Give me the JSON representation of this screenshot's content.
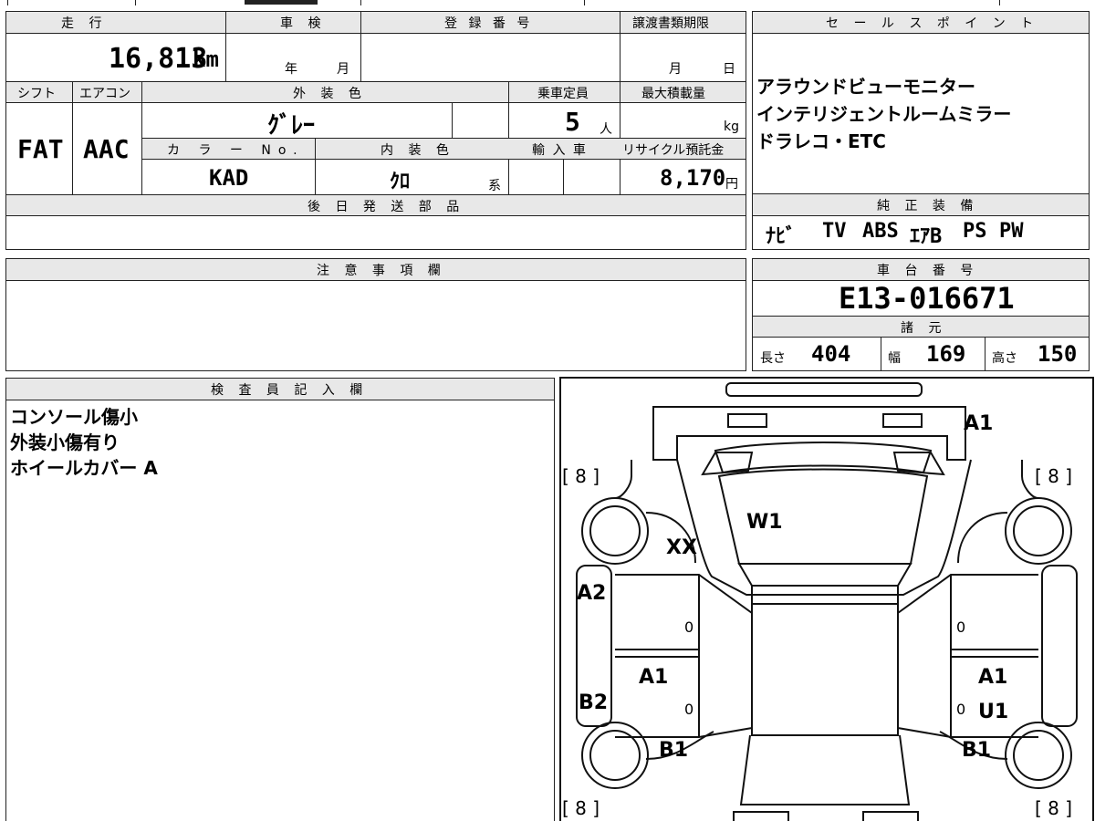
{
  "top_strip": [
    "",
    "",
    "",
    "",
    ""
  ],
  "basic": {
    "mileage_h": "走 行",
    "mileage": "16,813",
    "mileage_unit": "km",
    "inspection_h": "車 検",
    "inspection_year": "年",
    "inspection_month": "月",
    "reg_h": "登 録 番 号",
    "reg_value": "",
    "transfer_h": "譲渡書類期限",
    "transfer_month": "月",
    "transfer_day": "日",
    "shift_h": "シフト",
    "shift": "FAT",
    "aircon_h": "エアコン",
    "aircon": "AAC",
    "exterior_h": "外 装 色",
    "exterior": "ｸﾞﾚｰ",
    "capacity_h": "乗車定員",
    "capacity": "5",
    "capacity_unit": "人",
    "load_h": "最大積載量",
    "load_unit": "kg",
    "color_no_h": "カ ラ ー No.",
    "color_no": "KAD",
    "interior_h": "内 装 色",
    "interior": "ｸﾛ",
    "interior_unit": "系",
    "import_h": "輸 入 車",
    "recycle_h": "リサイクル預託金",
    "recycle": "8,170",
    "recycle_unit": "円",
    "later_parts_h": "後 日 発 送 部 品",
    "later_parts": ""
  },
  "sales_point": {
    "header": "セ ー ル ス ポ イ ン ト",
    "lines": [
      "アラウンドビューモニター",
      "インテリジェントルームミラー",
      "ドラレコ・ETC"
    ]
  },
  "equipment": {
    "header": "純 正 装 備",
    "items": [
      "ﾅﾋﾞ",
      "TV",
      "ABS",
      "ｴｱB",
      "PS",
      "PW"
    ]
  },
  "notes": {
    "header": "注 意 事 項 欄",
    "text": ""
  },
  "chassis": {
    "header": "車 台 番 号",
    "value": "E13-016671"
  },
  "specs": {
    "header": "諸 元",
    "length_label": "長さ",
    "length": "404",
    "width_label": "幅",
    "width": "169",
    "height_label": "高さ",
    "height": "150"
  },
  "inspector": {
    "header": "検 査 員 記 入 欄",
    "lines": [
      "コンソール傷小",
      "外装小傷有り",
      "ホイールカバー A"
    ]
  },
  "diagram": {
    "tire_fl": "[ 8 ]",
    "tire_fr": "[ 8 ]",
    "tire_rl": "[ 8 ]",
    "tire_rr": "[ 8 ]",
    "a1_front": "A1",
    "w1": "W1",
    "xx": "XX",
    "a2": "A2",
    "b2": "B2",
    "a1_left": "A1",
    "b1_left": "B1",
    "a1_right": "A1",
    "u1_right": "U1",
    "b1_right": "B1",
    "zero_1": "0",
    "zero_2": "0",
    "zero_3": "0",
    "zero_4": "0"
  }
}
